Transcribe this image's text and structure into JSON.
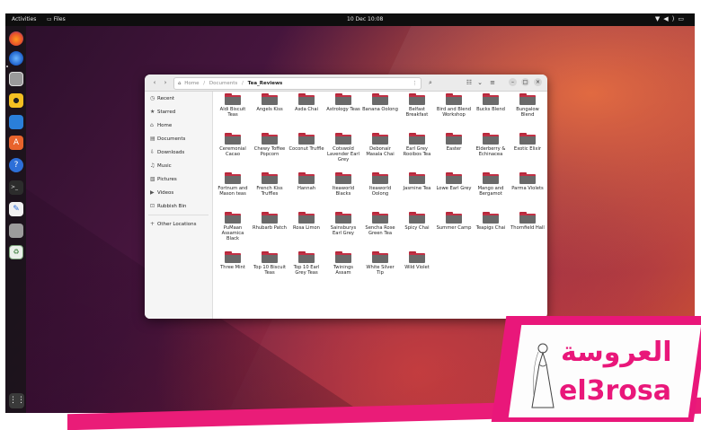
{
  "topbar": {
    "activities": "Activities",
    "app_name": "Files",
    "clock": "10 Dec  10:08",
    "tray_icons": [
      "network-icon",
      "volume-icon",
      "battery-icon"
    ]
  },
  "dock": {
    "apps": [
      "firefox-icon",
      "thunderbird-icon",
      "files-icon",
      "rhythmbox-icon",
      "writer-icon",
      "software-icon",
      "help-icon",
      "terminal-icon",
      "text-editor-icon",
      "blank-app-icon",
      "trash-icon"
    ],
    "apps_grid_icon": "grid-icon"
  },
  "window": {
    "path": [
      "Home",
      "Documents",
      "Tea_Reviews"
    ],
    "sidebar": [
      {
        "label": "Recent",
        "icon": "clock-icon"
      },
      {
        "label": "Starred",
        "icon": "star-icon"
      },
      {
        "label": "Home",
        "icon": "home-icon"
      },
      {
        "label": "Documents",
        "icon": "document-icon"
      },
      {
        "label": "Downloads",
        "icon": "download-icon"
      },
      {
        "label": "Music",
        "icon": "music-icon"
      },
      {
        "label": "Pictures",
        "icon": "picture-icon"
      },
      {
        "label": "Videos",
        "icon": "video-icon"
      },
      {
        "label": "Rubbish Bin",
        "icon": "trash-icon"
      },
      {
        "label": "Other Locations",
        "icon": "plus-icon"
      }
    ],
    "folders": [
      "Aldi Biscuit Teas",
      "Angels Kiss",
      "Asda Chai",
      "Astrology Teas",
      "Banana Oolong",
      "Belfast Breakfast",
      "Bird and Blend Workshop",
      "Bucks Blend",
      "Bungalow Blend",
      "Ceremonial Cacao",
      "Chewy Toffee Popcorn",
      "Coconut Truffle",
      "Cotswold Lavender Earl Grey",
      "Debonair Masala Chai",
      "Earl Grey Rooibos Tea",
      "Easter",
      "Elderberry & Echinacea",
      "Exotic Elixir",
      "Fortnum and Mason teas",
      "French Kiss Truffles",
      "Hannah",
      "Iteaworld Blacks",
      "Iteaworld Oolong",
      "Jasmine Tea",
      "Lowe Earl Grey",
      "Mango and Bergamot",
      "Parma Violets",
      "PuMaan Assamica Black",
      "Rhubarb Patch",
      "Rosa Limon",
      "Sainsburys Earl Grey",
      "Sencha Rose Green Tea",
      "Spicy Chai",
      "Summer Camp",
      "Teapigs Chai",
      "Thornfield Hall",
      "Three Mint",
      "Top 10 Biscuit Teas",
      "Top 10 Earl Grey Teas",
      "Twinings Assam",
      "White Silver Tip",
      "Wild Violet"
    ]
  },
  "watermark": {
    "arabic": "العروسة",
    "latin": "el3rosa"
  },
  "colors": {
    "folder_body": "#6a6a6a",
    "folder_accent": "#c23045",
    "brand_pink": "#e9177a"
  }
}
